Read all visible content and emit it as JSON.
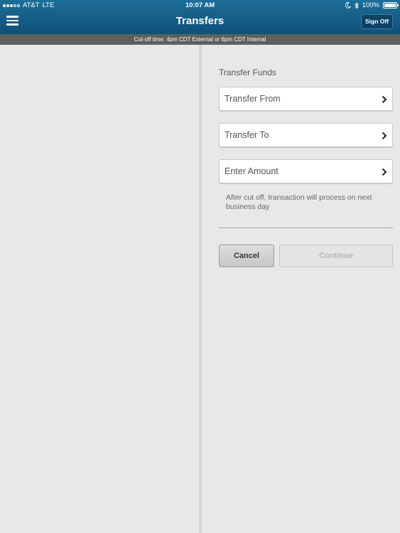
{
  "status_bar": {
    "carrier": "AT&T",
    "network": "LTE",
    "time": "10:07 AM",
    "battery": "100%",
    "battery_level": 1.0,
    "signal_bars_filled": 3,
    "signal_bars_total": 5,
    "icons": [
      "moon-icon",
      "bluetooth-icon",
      "battery-icon"
    ]
  },
  "header": {
    "title": "Transfers",
    "menu_icon": "hamburger-menu-icon",
    "sign_off_label": "Sign Off"
  },
  "banner": {
    "text": "Cut-off time: 4pm CDT External or 6pm CDT Internal"
  },
  "form": {
    "section_label": "Transfer Funds",
    "fields": [
      {
        "label": "Transfer From",
        "icon": "chevron-right-icon"
      },
      {
        "label": "Transfer To",
        "icon": "chevron-right-icon"
      },
      {
        "label": "Enter Amount",
        "icon": "chevron-right-icon"
      }
    ],
    "note": "After cut off, transaction will process on next business day",
    "cancel_label": "Cancel",
    "continue_label": "Continue"
  },
  "colors": {
    "header_top": "#1d6e98",
    "header_bottom": "#0f5079",
    "banner_bg": "#5f5f5f",
    "panel_bg": "#e8e8e8"
  }
}
